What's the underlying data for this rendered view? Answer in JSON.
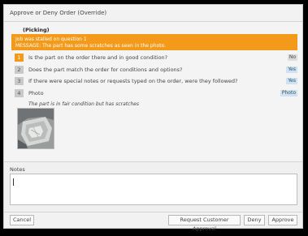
{
  "dialog": {
    "title": "Approve or Deny Order (Override)"
  },
  "group": {
    "label": "(Picking)"
  },
  "banner": {
    "line1": "Job was stalled on question 1",
    "line2": "MESSAGE: The part has some scratches as seen in the photo."
  },
  "questions": [
    {
      "number": "1",
      "text": "Is the part on the order there and in good condition?",
      "answer": "No"
    },
    {
      "number": "2",
      "text": "Does the part match the order for conditions and options?",
      "answer": "Yes"
    },
    {
      "number": "3",
      "text": "If there were special notes or requests typed on the order, were they followed?",
      "answer": "Yes"
    },
    {
      "number": "4",
      "text": "Photo",
      "answer": "Photo",
      "comment": "The part is in fair condition but has scratches"
    }
  ],
  "notes": {
    "label": "Notes",
    "value": ""
  },
  "buttons": {
    "cancel": "Cancel",
    "request_approval": "Request Customer Approval",
    "deny": "Deny",
    "approve": "Approve"
  },
  "colors": {
    "alert": "#f39a1a",
    "answer_yes": "#cfe2f5",
    "answer_no": "#dcdcdc"
  }
}
